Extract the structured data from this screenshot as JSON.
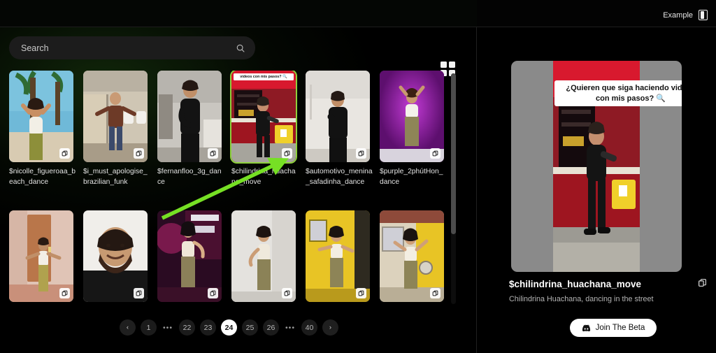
{
  "search": {
    "placeholder": "Search",
    "value": "",
    "icon": "search-icon"
  },
  "toolbar": {
    "grid_view_icon": "grid-view-icon"
  },
  "right_header": {
    "example_label": "Example",
    "panel_icon": "panel-toggle-icon"
  },
  "grid": {
    "rows": [
      {
        "cards": [
          {
            "label": "$nicolle_figueroaa_beach_dance",
            "selected": false,
            "badge": "copy-icon",
            "scene": "beach"
          },
          {
            "label": "$i_must_apologise_brazilian_funk",
            "selected": false,
            "badge": "copy-icon",
            "scene": "restroom"
          },
          {
            "label": "$fernanfloo_3g_dance",
            "selected": false,
            "badge": "copy-icon",
            "scene": "bedroom"
          },
          {
            "label": "$chilindrina_huachana_move",
            "selected": true,
            "badge": "copy-icon",
            "scene": "street",
            "overlay_caption": "videos con mis pasos? 🔍"
          },
          {
            "label": "$automotivo_menina_safadinha_dance",
            "selected": false,
            "badge": "copy-icon",
            "scene": "whiteroom"
          },
          {
            "label": "$purple_2phútHon_dance",
            "selected": false,
            "badge": "copy-icon",
            "scene": "purple"
          }
        ]
      },
      {
        "cards": [
          {
            "label": "",
            "selected": false,
            "badge": "copy-icon",
            "scene": "hallway"
          },
          {
            "label": "",
            "selected": false,
            "badge": "copy-icon",
            "scene": "portrait"
          },
          {
            "label": "",
            "selected": false,
            "badge": "copy-icon",
            "scene": "neon"
          },
          {
            "label": "",
            "selected": false,
            "badge": "copy-icon",
            "scene": "plainwall"
          },
          {
            "label": "",
            "selected": false,
            "badge": "copy-icon",
            "scene": "yellowroom"
          },
          {
            "label": "",
            "selected": false,
            "badge": "copy-icon",
            "scene": "patio"
          }
        ]
      }
    ]
  },
  "pagination": {
    "prev_label": "‹",
    "next_label": "›",
    "ellipsis": "•••",
    "items": [
      "1",
      "•••",
      "22",
      "23",
      "24",
      "25",
      "26",
      "•••",
      "40"
    ],
    "current": "24"
  },
  "detail": {
    "preview_caption": "¿Quieren que siga haciendo videos con mis pasos? 🔍",
    "title": "$chilindrina_huachana_move",
    "description": "Chilindrina Huachana, dancing in the street",
    "copy_icon": "copy-icon",
    "cta_label": "Join The Beta",
    "cta_icon": "discord-icon"
  },
  "colors": {
    "selection_green": "#8dd13c",
    "annotation_green": "#76e024",
    "background": "#000000",
    "surface": "#1c1c1c",
    "accent_white": "#ffffff"
  },
  "annotation": {
    "type": "arrow",
    "color": "#76e024"
  }
}
